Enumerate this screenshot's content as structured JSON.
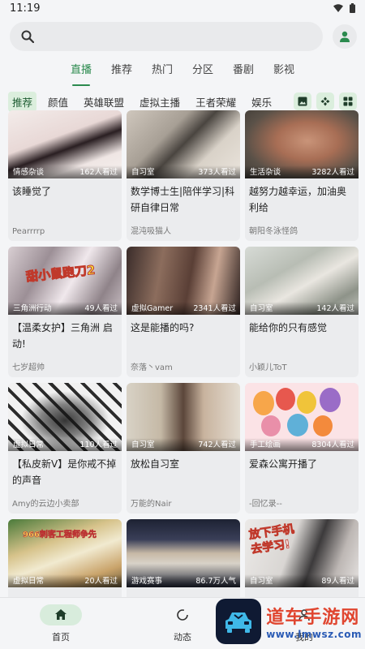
{
  "status": {
    "time": "11:19"
  },
  "search": {
    "placeholder": ""
  },
  "main_tabs": [
    "直播",
    "推荐",
    "热门",
    "分区",
    "番剧",
    "影视"
  ],
  "sub_tabs": [
    "推荐",
    "颜值",
    "英雄联盟",
    "虚拟主播",
    "王者荣耀",
    "娱乐"
  ],
  "sub_icons": [
    "image-icon",
    "gamepad-icon",
    "grid-icon"
  ],
  "cards": [
    {
      "tag": "情感杂谈",
      "viewers": "162人看过",
      "title": "该睡觉了",
      "streamer": "Pearrrrp"
    },
    {
      "tag": "自习室",
      "viewers": "373人看过",
      "title": "数学博士生|陪伴学习|科研自律日常",
      "streamer": "混沌吸猫人"
    },
    {
      "tag": "生活杂谈",
      "viewers": "3282人看过",
      "title": "越努力越幸运，加油奥利给",
      "streamer": "朝阳冬泳怪鸽"
    },
    {
      "tag": "三角洲行动",
      "viewers": "49人看过",
      "title": "【温柔女护】三角洲 启动!",
      "streamer": "七岁超帅",
      "overlay": "甜小鼠跑刀2"
    },
    {
      "tag": "虚拟Gamer",
      "viewers": "2341人看过",
      "title": "这是能播的吗?",
      "streamer": "奈落丶vam"
    },
    {
      "tag": "自习室",
      "viewers": "142人看过",
      "title": "能给你的只有感觉",
      "streamer": "小颖儿ToT"
    },
    {
      "tag": "虚拟日常",
      "viewers": "110人看过",
      "title": "【私皮新V】是你戒不掉的声音",
      "streamer": "Amy的云边小卖部"
    },
    {
      "tag": "自习室",
      "viewers": "742人看过",
      "title": "放松自习室",
      "streamer": "万能的Nair"
    },
    {
      "tag": "手工绘画",
      "viewers": "8304人看过",
      "title": "爱森公寓开播了",
      "streamer": "-回忆录--"
    },
    {
      "tag": "虚拟日常",
      "viewers": "20人看过",
      "title": "",
      "streamer": "",
      "overlay": "966刺客工程师争先"
    },
    {
      "tag": "游戏赛事",
      "viewers": "86.7万人气",
      "title": "",
      "streamer": ""
    },
    {
      "tag": "自习室",
      "viewers": "89人看过",
      "title": "",
      "streamer": "",
      "overlay": "放下手机 去学习!"
    }
  ],
  "bottom_nav": [
    {
      "label": "首页",
      "icon": "home-icon"
    },
    {
      "label": "动态",
      "icon": "activity-icon"
    },
    {
      "label": "我的",
      "icon": "profile-icon"
    }
  ],
  "watermark": {
    "cn": "道车手游网",
    "url": "www.lmwsz.com"
  },
  "colors": {
    "accent": "#2b8a4e",
    "accent_bg": "#dbeedd",
    "background": "#f4f5f7",
    "card": "#ebecee"
  }
}
